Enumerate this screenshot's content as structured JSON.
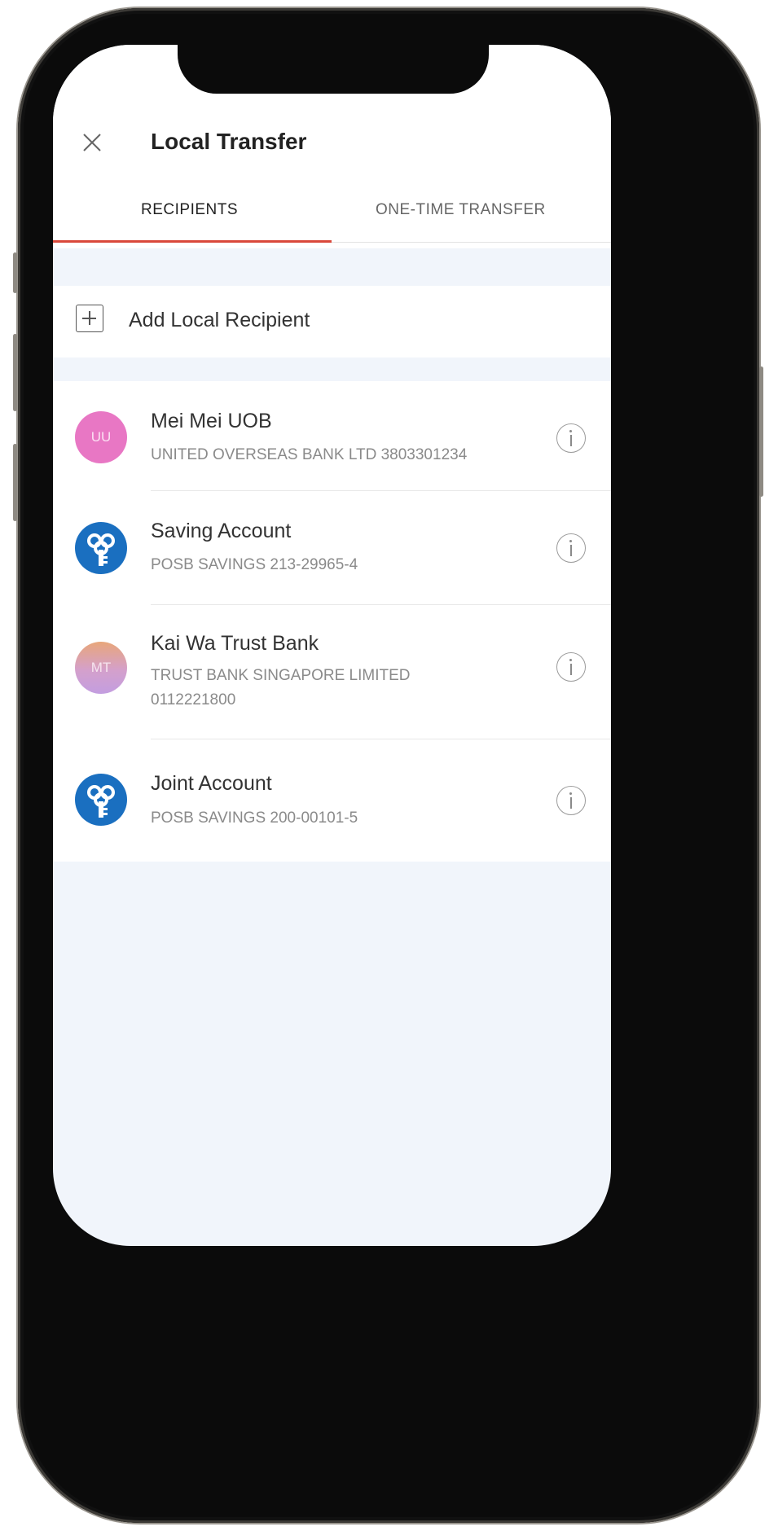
{
  "header": {
    "title": "Local Transfer",
    "tabs": [
      {
        "label": "RECIPIENTS",
        "active": true
      },
      {
        "label": "ONE-TIME TRANSFER",
        "active": false
      }
    ]
  },
  "add_recipient": {
    "label": "Add Local Recipient"
  },
  "recipients": [
    {
      "initials": "UU",
      "name": "Mei Mei UOB",
      "detail": "UNITED OVERSEAS BANK LTD 3803301234",
      "avatar_color": "#e877c4",
      "avatar_type": "initials"
    },
    {
      "initials": "",
      "name": "Saving Account",
      "detail": "POSB SAVINGS 213-29965-4",
      "avatar_color": "#1a6fc0",
      "avatar_type": "posb-logo"
    },
    {
      "initials": "MT",
      "name": "Kai Wa Trust Bank",
      "detail": "TRUST BANK SINGAPORE LIMITED 0112221800",
      "avatar_color": "#d8a6c8",
      "avatar_type": "initials"
    },
    {
      "initials": "",
      "name": "Joint Account",
      "detail": "POSB SAVINGS 200-00101-5",
      "avatar_color": "#1a6fc0",
      "avatar_type": "posb-logo"
    }
  ],
  "colors": {
    "accent": "#d9483b",
    "background": "#f1f5fb"
  }
}
